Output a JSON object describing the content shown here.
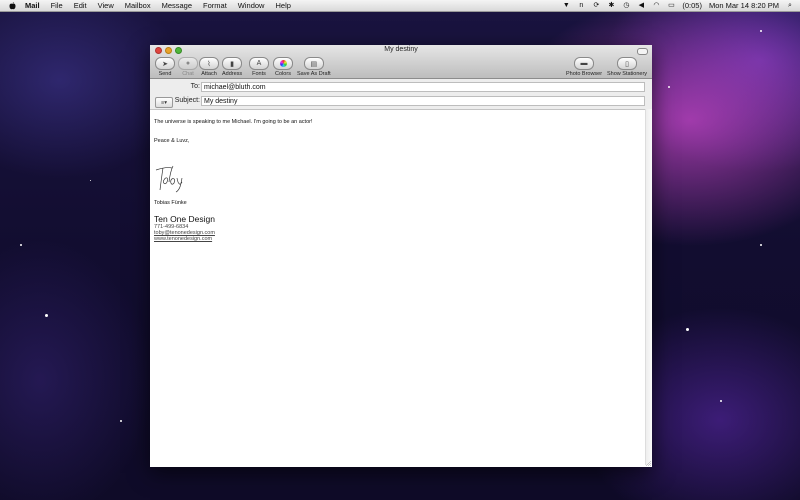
{
  "menubar": {
    "app": "Mail",
    "items": [
      "File",
      "Edit",
      "View",
      "Mailbox",
      "Message",
      "Format",
      "Window",
      "Help"
    ],
    "battery": "(0:05)",
    "clock": "Mon Mar 14  8:20 PM"
  },
  "window": {
    "title": "My destiny",
    "toolbar": {
      "send": "Send",
      "chat": "Chat",
      "attach": "Attach",
      "address": "Address",
      "fonts": "Fonts",
      "colors": "Colors",
      "save_draft": "Save As Draft",
      "photo_browser": "Photo Browser",
      "show_stationery": "Show Stationery"
    },
    "to_label": "To:",
    "to_value": "michael@bluth.com",
    "subject_label": "Subject:",
    "subject_value": "My destiny"
  },
  "message": {
    "line1": "The universe is speaking to me Michael.  I'm going to be an actor!",
    "closing": "Peace & Luvz,",
    "signature_name": "Tobias Fünke",
    "company": "Ten One Design",
    "phone": "771-499-6834",
    "email": "toby@tenonedesign.com",
    "website": "www.tenonedesign.com"
  }
}
